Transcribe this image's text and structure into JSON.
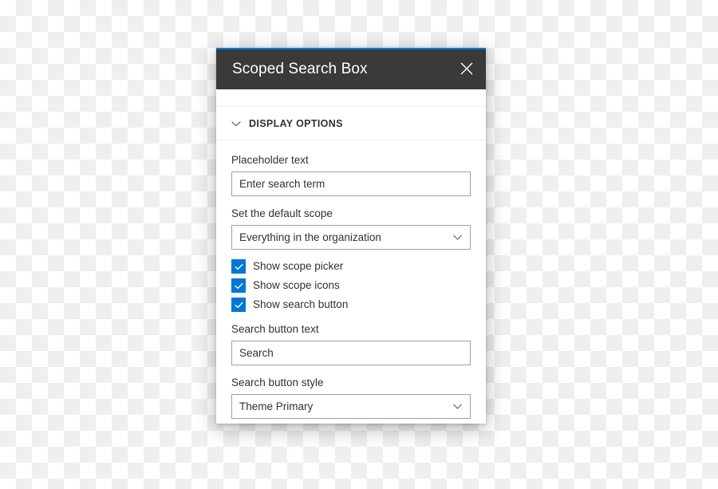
{
  "panel": {
    "title": "Scoped Search Box",
    "close_icon": "close-icon",
    "accent_color": "#0078d4",
    "header_bg": "#3b3a39"
  },
  "section": {
    "chevron_icon": "chevron-down-icon",
    "title": "DISPLAY OPTIONS"
  },
  "fields": {
    "placeholder_text": {
      "label": "Placeholder text",
      "value": "Enter search term"
    },
    "default_scope": {
      "label": "Set the default scope",
      "value": "Everything in the organization",
      "chevron_icon": "chevron-down-icon"
    },
    "search_button_text": {
      "label": "Search button text",
      "value": "Search"
    },
    "search_button_style": {
      "label": "Search button style",
      "value": "Theme Primary",
      "chevron_icon": "chevron-down-icon"
    }
  },
  "checkboxes": [
    {
      "label": "Show scope picker",
      "checked": true,
      "color": "#0078d4"
    },
    {
      "label": "Show scope icons",
      "checked": true,
      "color": "#0078d4"
    },
    {
      "label": "Show search button",
      "checked": true,
      "color": "#0078d4"
    }
  ]
}
